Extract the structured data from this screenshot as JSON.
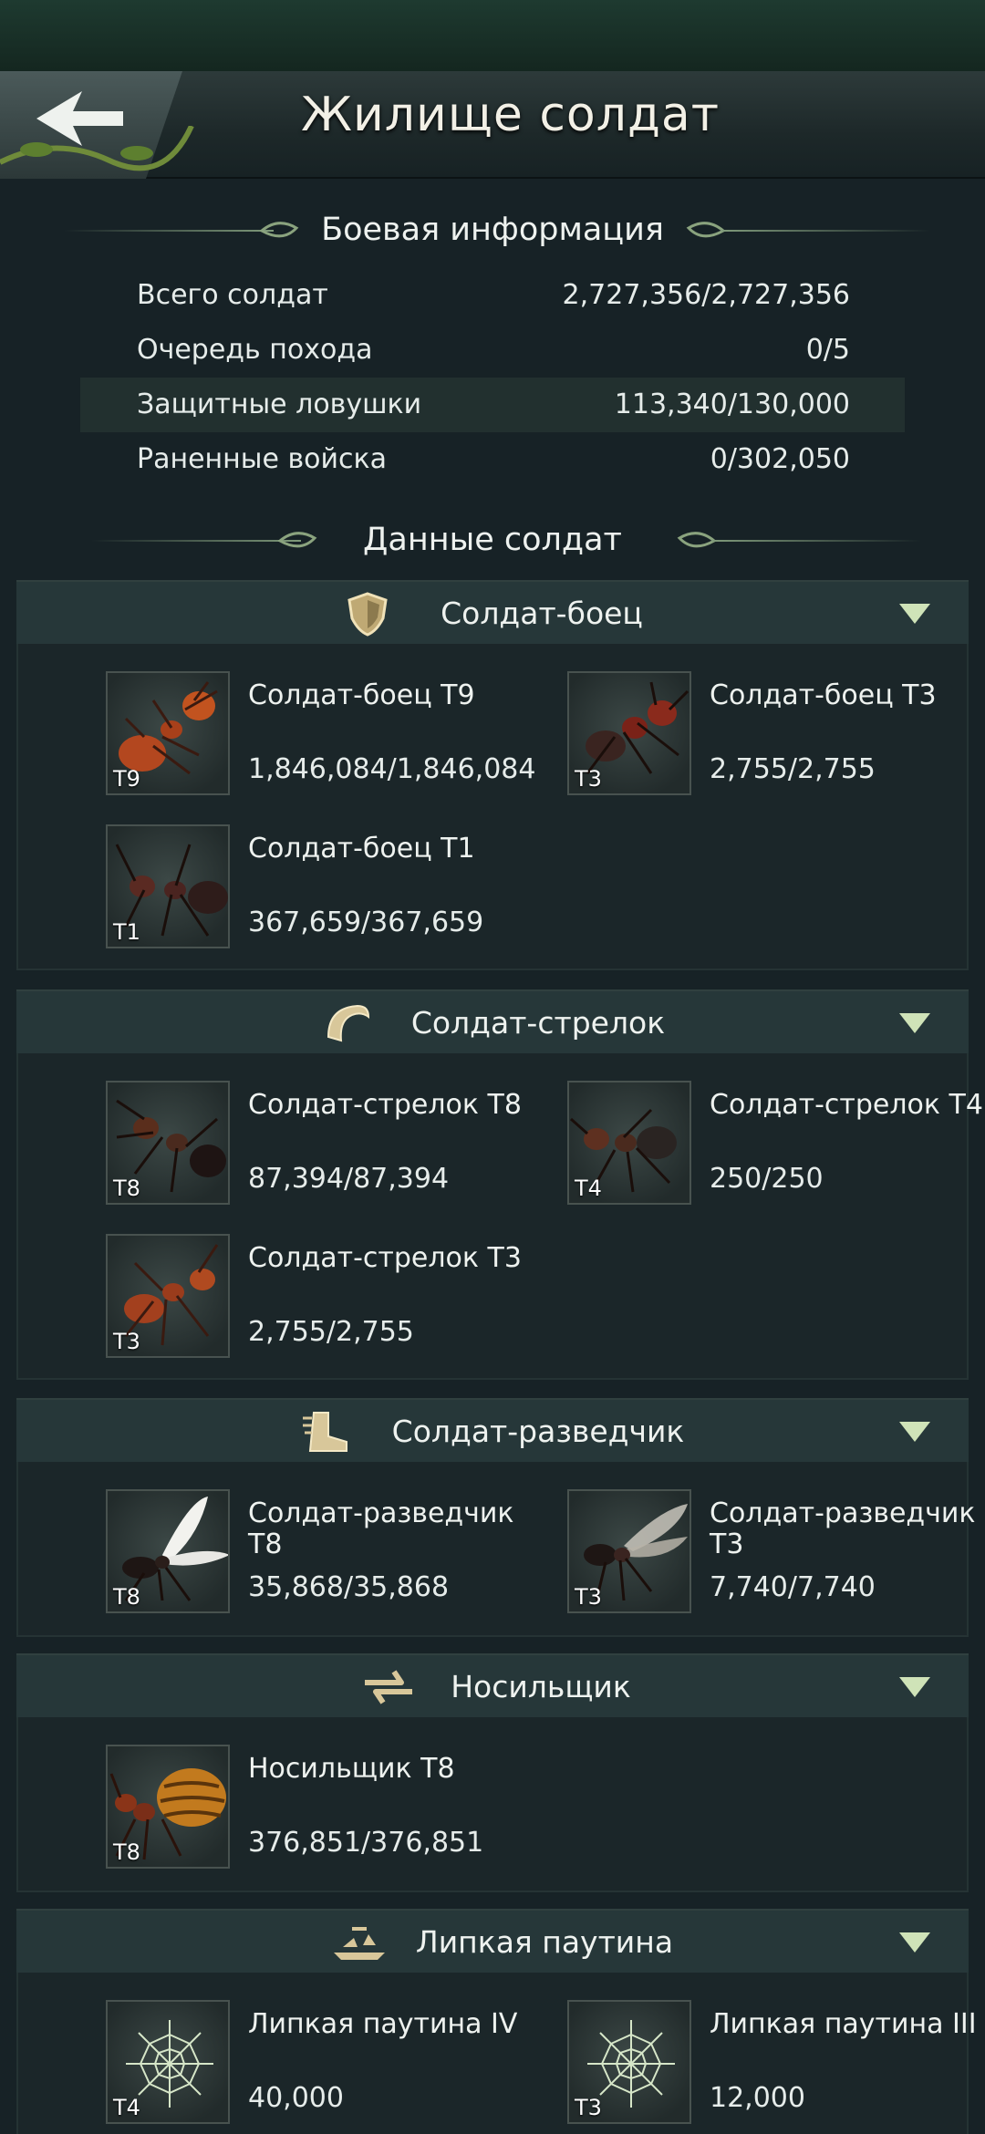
{
  "header": {
    "title": "Жилище солдат"
  },
  "battle_info": {
    "title": "Боевая информация",
    "rows": [
      {
        "label": "Всего солдат",
        "value": "2,727,356/2,727,356"
      },
      {
        "label": "Очередь похода",
        "value": "0/5"
      },
      {
        "label": "Защитные ловушки",
        "value": "113,340/130,000"
      },
      {
        "label": "Раненные войска",
        "value": "0/302,050"
      }
    ]
  },
  "soldier_data": {
    "title": "Данные солдат"
  },
  "categories": [
    {
      "title": "Солдат-боец",
      "icon": "shield-icon",
      "units": [
        {
          "name": "Солдат-боец T9",
          "count": "1,846,084/1,846,084",
          "tier": "T9"
        },
        {
          "name": "Солдат-боец T3",
          "count": "2,755/2,755",
          "tier": "T3"
        },
        {
          "name": "Солдат-боец T1",
          "count": "367,659/367,659",
          "tier": "T1"
        }
      ]
    },
    {
      "title": "Солдат-стрелок",
      "icon": "bow-icon",
      "units": [
        {
          "name": "Солдат-стрелок T8",
          "count": "87,394/87,394",
          "tier": "T8"
        },
        {
          "name": "Солдат-стрелок T4",
          "count": "250/250",
          "tier": "T4"
        },
        {
          "name": "Солдат-стрелок T3",
          "count": "2,755/2,755",
          "tier": "T3"
        }
      ]
    },
    {
      "title": "Солдат-разведчик",
      "icon": "boot-icon",
      "units": [
        {
          "name": "Солдат-разведчик T8",
          "count": "35,868/35,868",
          "tier": "T8"
        },
        {
          "name": "Солдат-разведчик T3",
          "count": "7,740/7,740",
          "tier": "T3"
        }
      ]
    },
    {
      "title": "Носильщик",
      "icon": "transport-arrows-icon",
      "units": [
        {
          "name": "Носильщик T8",
          "count": "376,851/376,851",
          "tier": "T8"
        }
      ]
    },
    {
      "title": "Липкая паутина",
      "icon": "web-trap-icon",
      "units": [
        {
          "name": "Липкая паутина IV",
          "count": "40,000",
          "tier": "T4"
        },
        {
          "name": "Липкая паутина III",
          "count": "12,000",
          "tier": "T3"
        }
      ]
    }
  ],
  "colors": {
    "background": "#172226",
    "category_header": "#263739",
    "accent_triangle": "#cfe3b8",
    "icon_gold": "#d8c79a"
  }
}
